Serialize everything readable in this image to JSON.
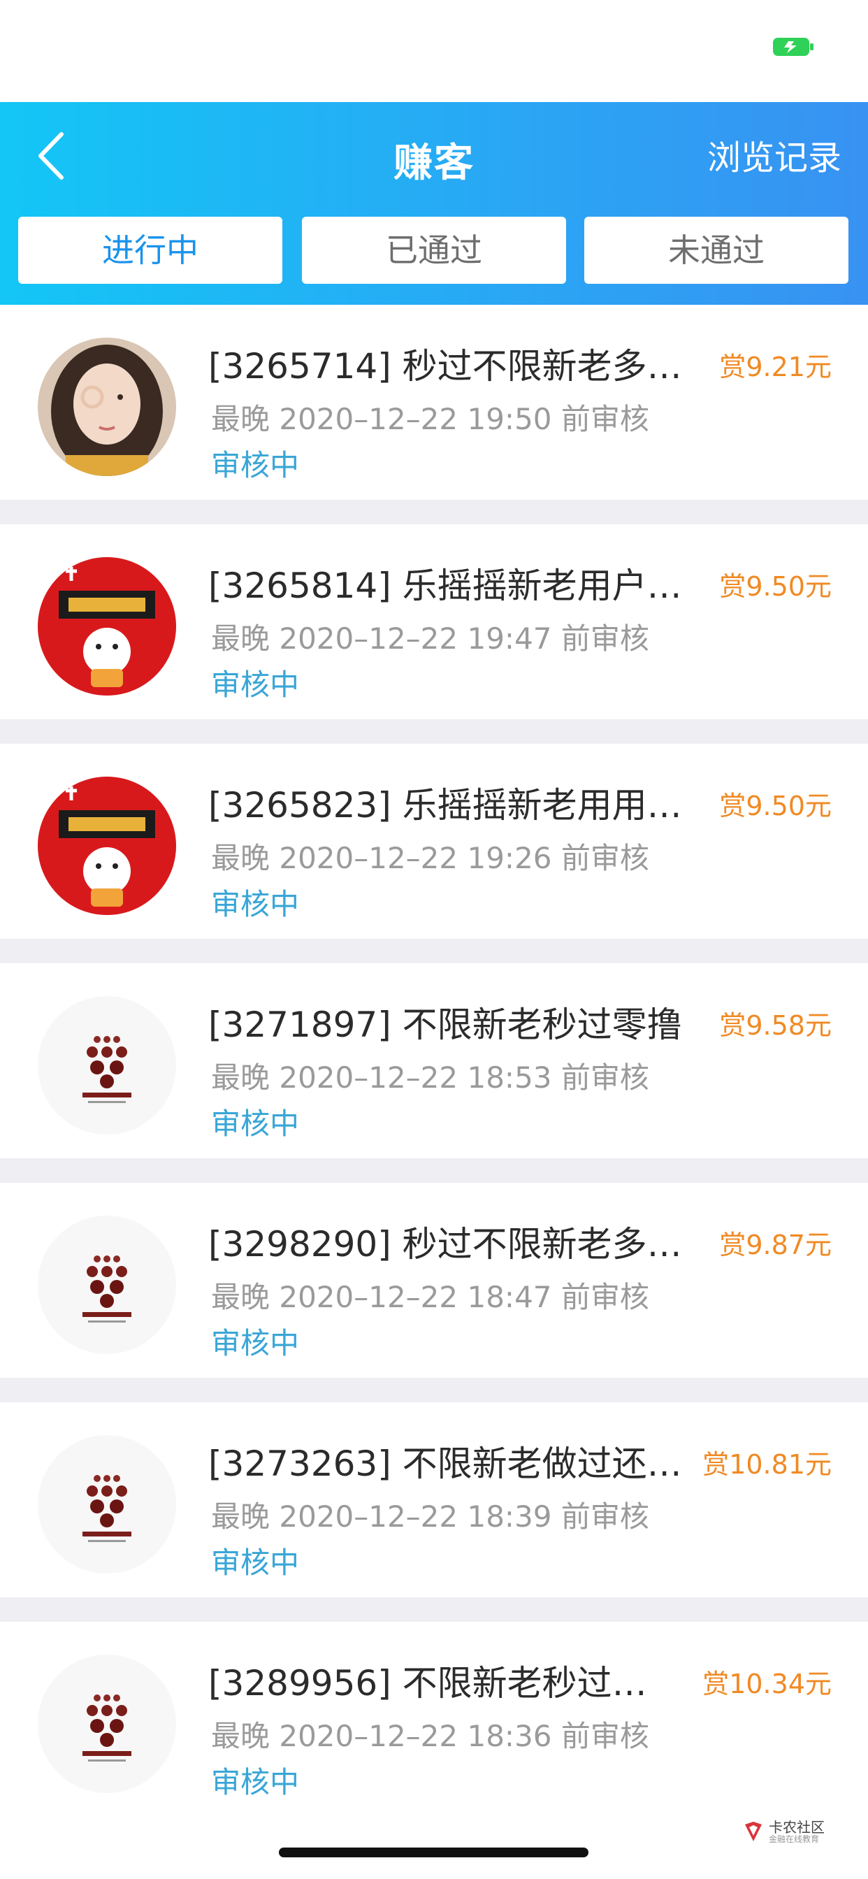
{
  "status_bar": {
    "battery_icon": "battery-charging-icon",
    "battery_color": "#2fd158"
  },
  "header": {
    "title": "赚客",
    "back_icon": "chevron-left-icon",
    "history_label": "浏览记录"
  },
  "tabs": [
    {
      "label": "进行中",
      "active": true
    },
    {
      "label": "已通过",
      "active": false
    },
    {
      "label": "未通过",
      "active": false
    }
  ],
  "accent_colors": {
    "header_start": "#13c6f6",
    "header_end": "#3892f2",
    "reward": "#f08a24",
    "status": "#3aa6d6"
  },
  "tasks": [
    {
      "title": "[3265714] 秒过不限新老多…",
      "deadline": "最晚 2020–12–22 19:50 前审核",
      "status": "审核中",
      "reward": "赏9.21元",
      "avatar": "girl-photo-avatar"
    },
    {
      "title": "[3265814] 乐摇摇新老用户…",
      "deadline": "最晚 2020–12–22 19:47 前审核",
      "status": "审核中",
      "reward": "赏9.50元",
      "avatar": "lucky-cat-avatar"
    },
    {
      "title": "[3265823] 乐摇摇新老用用…",
      "deadline": "最晚 2020–12–22 19:26 前审核",
      "status": "审核中",
      "reward": "赏9.50元",
      "avatar": "lucky-cat-avatar"
    },
    {
      "title": "[3271897] 不限新老秒过零撸",
      "deadline": "最晚 2020–12–22 18:53 前审核",
      "status": "审核中",
      "reward": "赏9.58元",
      "avatar": "dots-logo-avatar"
    },
    {
      "title": "[3298290] 秒过不限新老多…",
      "deadline": "最晚 2020–12–22 18:47 前审核",
      "status": "审核中",
      "reward": "赏9.87元",
      "avatar": "dots-logo-avatar"
    },
    {
      "title": "[3273263] 不限新老做过还…",
      "deadline": "最晚 2020–12–22 18:39 前审核",
      "status": "审核中",
      "reward": "赏10.81元",
      "avatar": "dots-logo-avatar"
    },
    {
      "title": "[3289956] 不限新老秒过…",
      "deadline": "最晚 2020–12–22 18:36 前审核",
      "status": "审核中",
      "reward": "赏10.34元",
      "avatar": "dots-logo-avatar"
    }
  ],
  "watermark": {
    "line1": "卡农社区",
    "line2": "金融在线教育"
  }
}
